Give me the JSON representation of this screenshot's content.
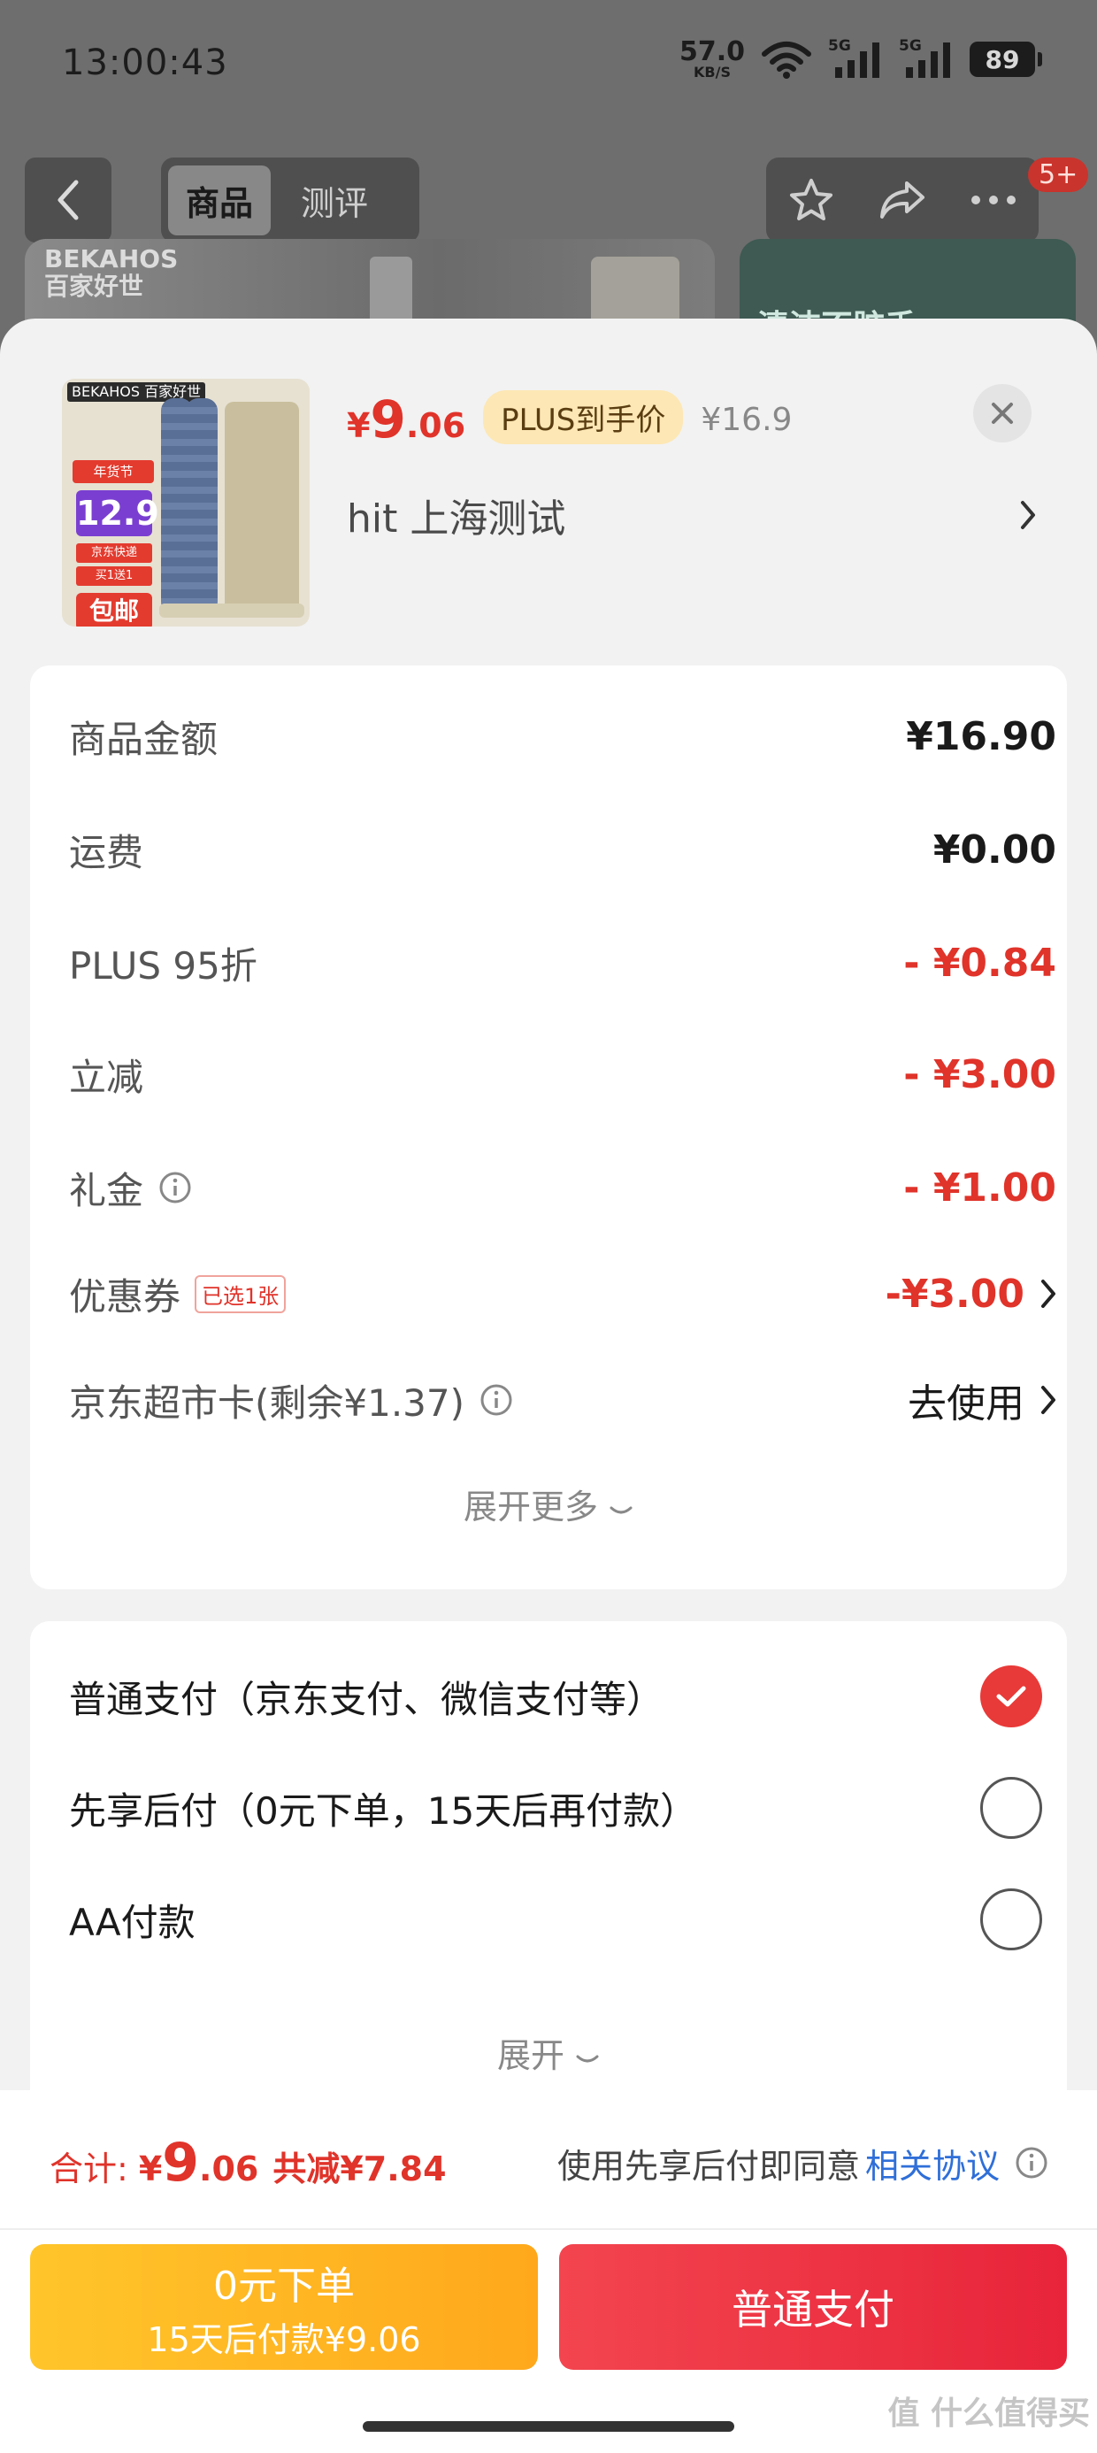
{
  "status_bar": {
    "time": "13:00:43",
    "net_speed": "57.0",
    "net_unit": "KB/S",
    "signal_1": "5G",
    "signal_2": "5G",
    "battery": "89"
  },
  "nav": {
    "tabs": [
      "商品",
      "测评"
    ],
    "active_tab": "商品",
    "cart_badge": "5+"
  },
  "background": {
    "brand_line1": "BEKAHOS",
    "brand_line2": "百家好世",
    "banner_text": "清洁不脏手"
  },
  "product": {
    "image_brand": "BEKAHOS 百家好世",
    "image_badges": [
      "年货节",
      "12.9",
      "京东快递",
      "买1送1",
      "包邮"
    ],
    "price_symbol": "¥",
    "price_int": "9",
    "price_dec": ".06",
    "plus_label": "PLUS到手价",
    "original_price": "¥16.9",
    "address": "hit  上海测试"
  },
  "price_detail": {
    "rows": [
      {
        "label": "商品金额",
        "value": "¥16.90"
      },
      {
        "label": "运费",
        "value": "¥0.00"
      },
      {
        "label": "PLUS 95折",
        "value": "- ¥0.84"
      },
      {
        "label": "立减",
        "value": "- ¥3.00"
      },
      {
        "label": "礼金",
        "value": "- ¥1.00"
      },
      {
        "label": "优惠券",
        "tag": "已选1张",
        "value": "-¥3.00"
      },
      {
        "label": "京东超市卡(剩余¥1.37)",
        "value": "去使用"
      }
    ],
    "expand_label": "展开更多"
  },
  "payment": {
    "options": [
      {
        "label": "普通支付（京东支付、微信支付等）",
        "selected": true
      },
      {
        "label": "先享后付（0元下单，15天后再付款）",
        "selected": false
      },
      {
        "label": "AA付款",
        "selected": false
      }
    ],
    "expand_label": "展开"
  },
  "footer": {
    "total_label": "合计:",
    "total_symbol": "¥",
    "total_int": "9",
    "total_dec": ".06",
    "total_saved": "共减¥7.84",
    "agree_prefix": "使用先享后付即同意",
    "agree_link": "相关协议",
    "bnpl_line1": "0元下单",
    "bnpl_line2": "15天后付款¥9.06",
    "pay_button": "普通支付",
    "watermark": "值 什么值得买"
  },
  "colors": {
    "accent_red": "#e0332a",
    "radio_red": "#e83a38",
    "link_blue": "#2f6fd8",
    "bnpl_yellow": "#ffb823",
    "pay_red": "#ee3446"
  }
}
